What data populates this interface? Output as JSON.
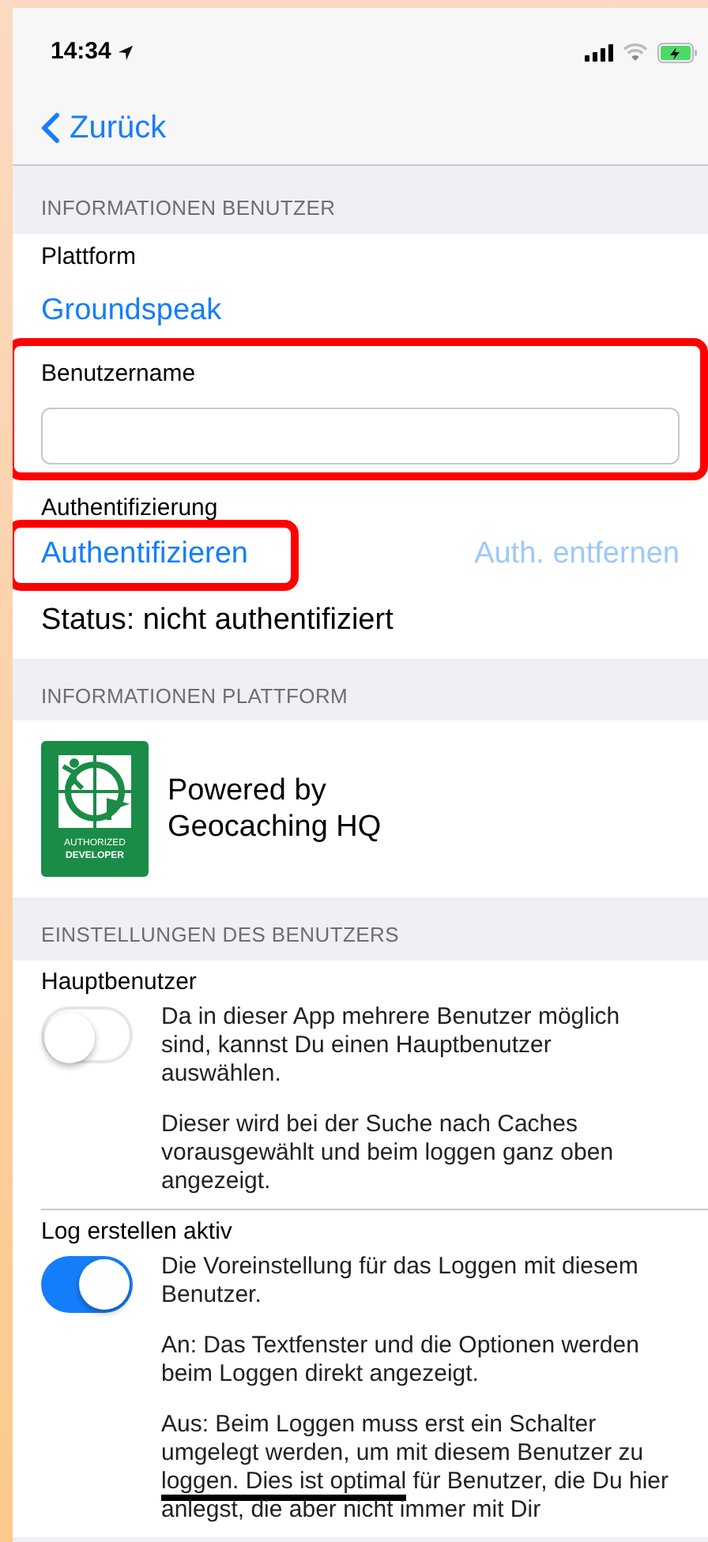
{
  "status_bar": {
    "time": "14:34",
    "location_active": true,
    "battery_charging": true
  },
  "nav": {
    "back_label": "Zurück"
  },
  "sections": [
    {
      "kind": "user",
      "header": "INFORMATIONEN BENUTZER",
      "platform_label": "Plattform",
      "platform_value": "Groundspeak",
      "username": {
        "label": "Benutzername",
        "highlighted": true
      },
      "auth_label": "Authentifizierung",
      "auth_button": {
        "label": "Authentifizieren",
        "highlighted": true,
        "disabled": false
      },
      "remove_button": {
        "label": "Auth. entfernen",
        "disabled": true
      },
      "status": "Status: nicht authentifiziert"
    },
    {
      "kind": "platform",
      "header": "INFORMATIONEN PLATTFORM",
      "logo": {
        "line_1": "AUTHORIZED",
        "line_2": "DEVELOPER"
      },
      "powered_by": "Powered by\nGeocaching HQ"
    },
    {
      "kind": "settings",
      "header": "EINSTELLUNGEN DES BENUTZERS",
      "items": [
        {
          "label": "Hauptbenutzer",
          "on": false,
          "paragraphs": [
            [
              {
                "text": "Da in dieser App mehrere Benutzer möglich sind, kannst Du einen Hauptbenutzer auswählen."
              }
            ],
            [
              {
                "text": "Dieser wird bei der Suche nach Caches vorausgewählt und beim loggen ganz oben angezeigt."
              }
            ]
          ]
        },
        {
          "label": "Log erstellen aktiv",
          "on": true,
          "paragraphs": [
            [
              {
                "text": "Die Voreinstellung für das Loggen mit diesem Benutzer."
              }
            ],
            [
              {
                "text": "An: Das Textfenster und die Optionen werden beim Loggen direkt angezeigt."
              }
            ],
            [
              {
                "text": "Aus: Beim Loggen muss erst ein Schalter umgelegt werden, um mit diesem Benutzer zu "
              },
              {
                "text": "loggen. Dies ist optimal",
                "underlined": true
              },
              {
                "text": " für Benutzer, die Du hier anlegst, die aber nicht immer mit Dir"
              }
            ]
          ]
        }
      ]
    }
  ]
}
